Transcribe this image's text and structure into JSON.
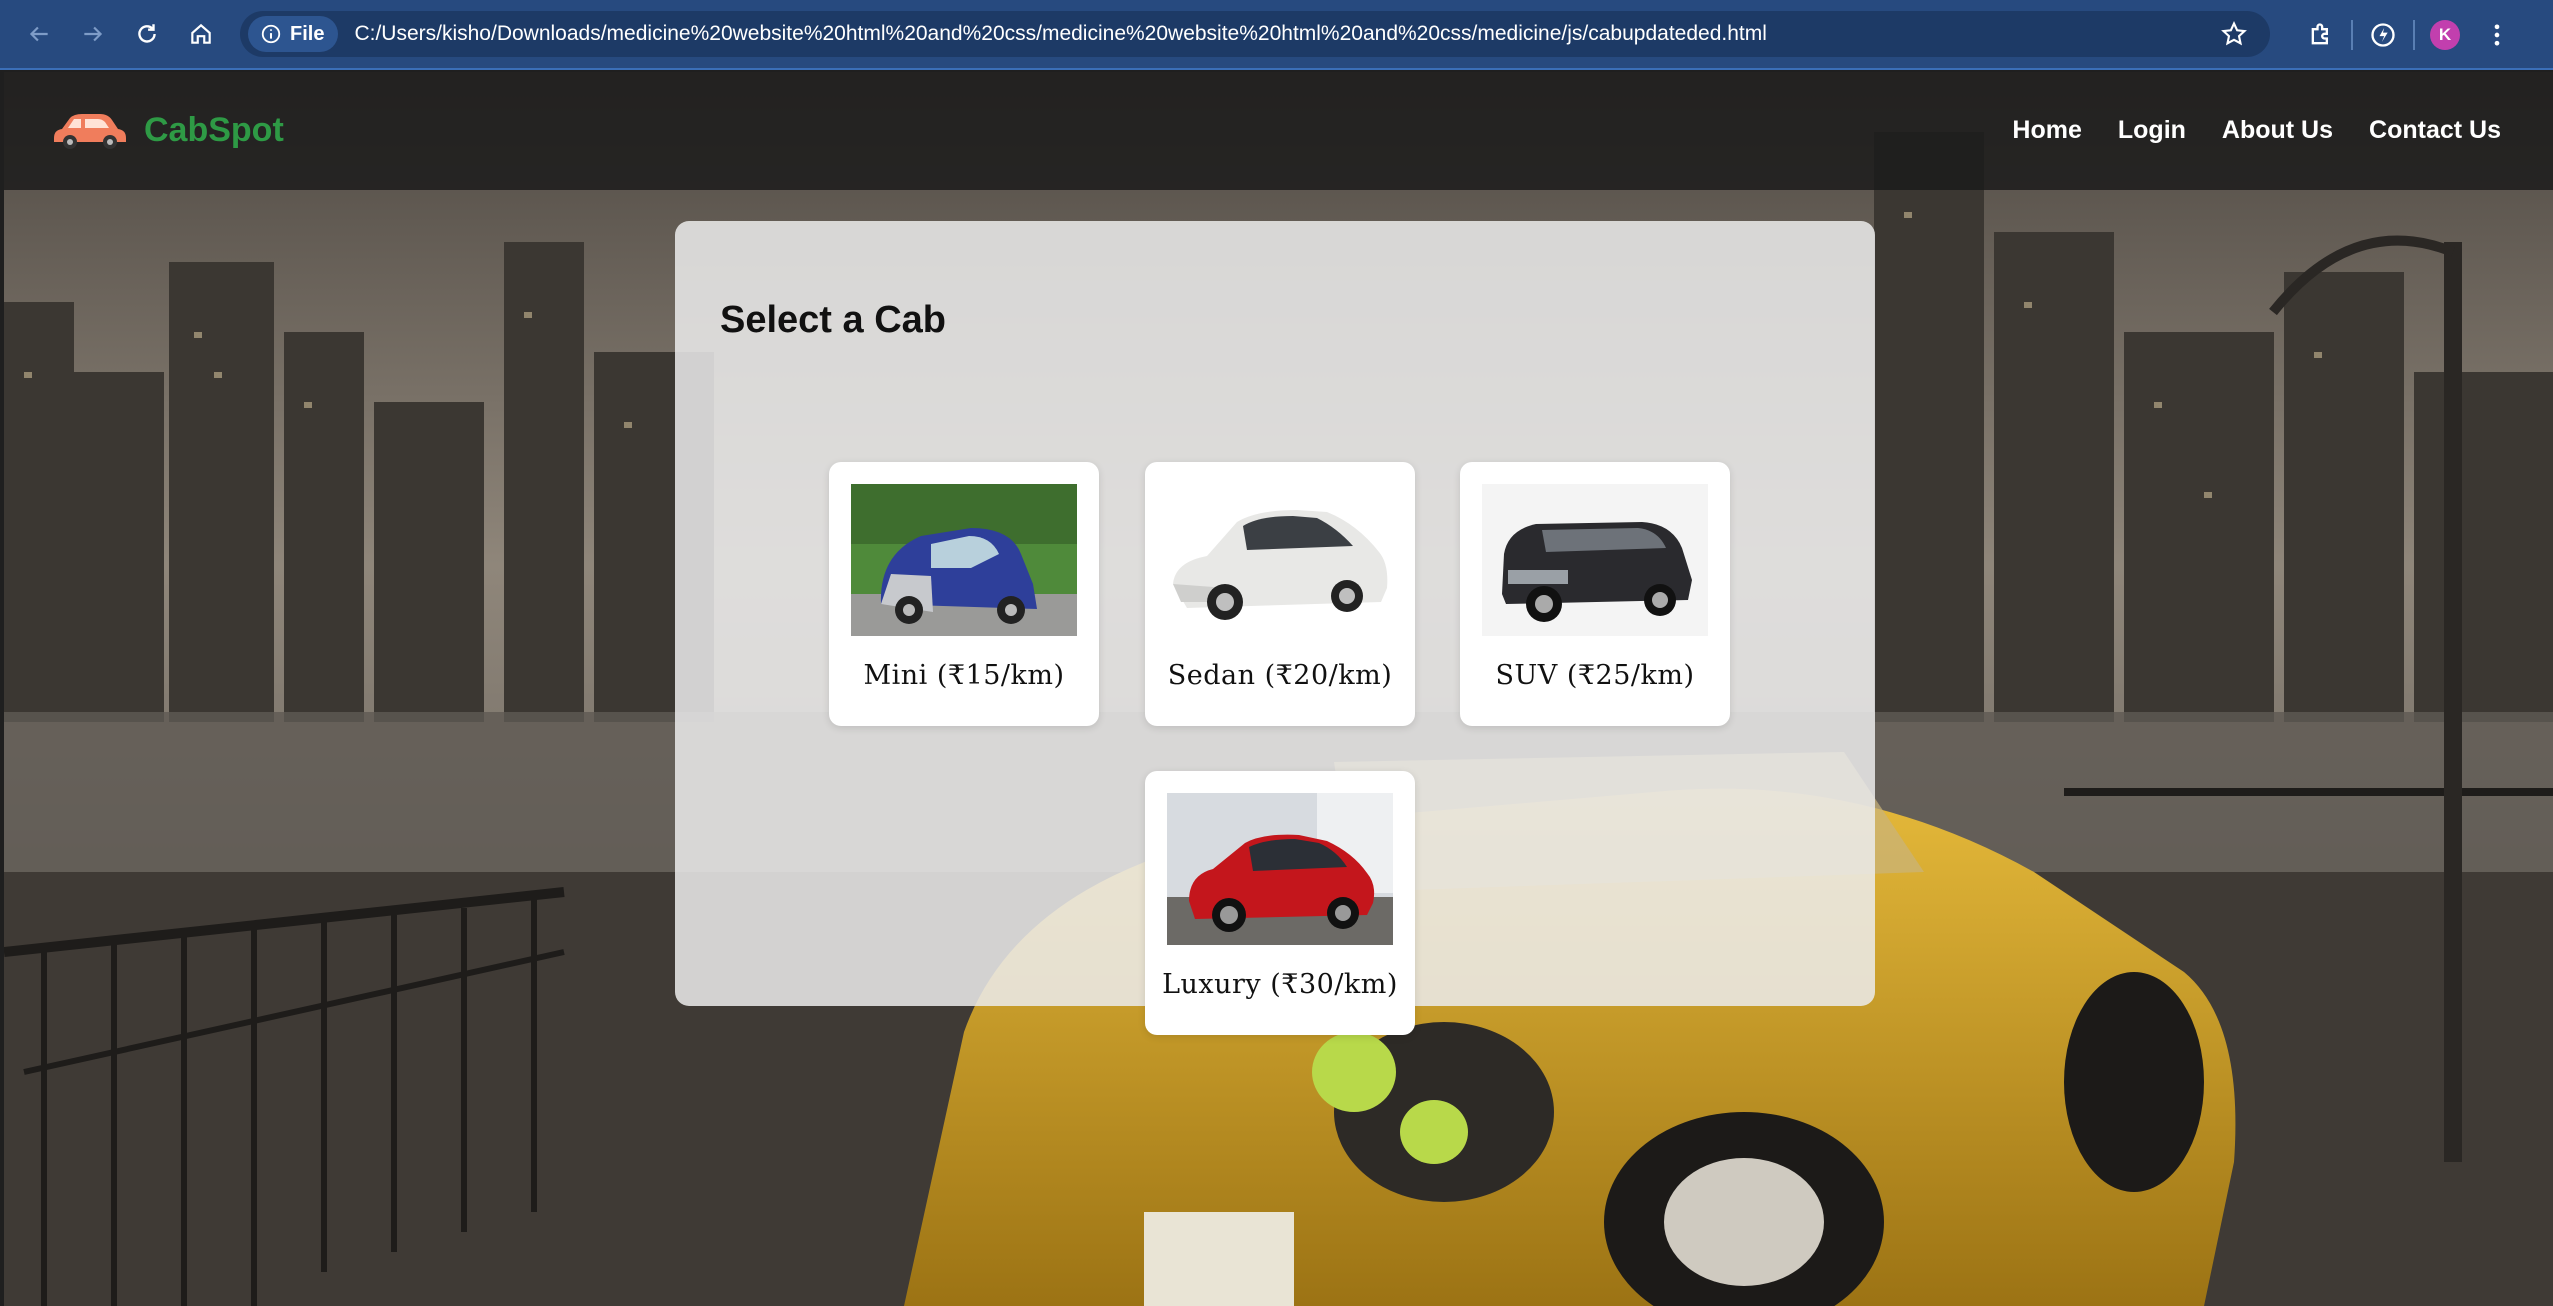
{
  "browser": {
    "site_chip_label": "File",
    "url": "C:/Users/kisho/Downloads/medicine%20website%20html%20and%20css/medicine%20website%20html%20and%20css/medicine/js/cabupdateded.html",
    "profile_initial": "K",
    "accent_color": "#274a7f"
  },
  "site": {
    "brand": "CabSpot",
    "brand_color": "#2e9a45",
    "nav": [
      "Home",
      "Login",
      "About Us",
      "Contact Us"
    ]
  },
  "panel": {
    "title": "Select a Cab",
    "cabs": [
      {
        "label": "Mini (₹15/km)",
        "icon": "mini-car-photo"
      },
      {
        "label": "Sedan (₹20/km)",
        "icon": "sedan-car-photo"
      },
      {
        "label": "SUV (₹25/km)",
        "icon": "suv-car-photo"
      },
      {
        "label": "Luxury (₹30/km)",
        "icon": "luxury-car-photo"
      }
    ]
  }
}
